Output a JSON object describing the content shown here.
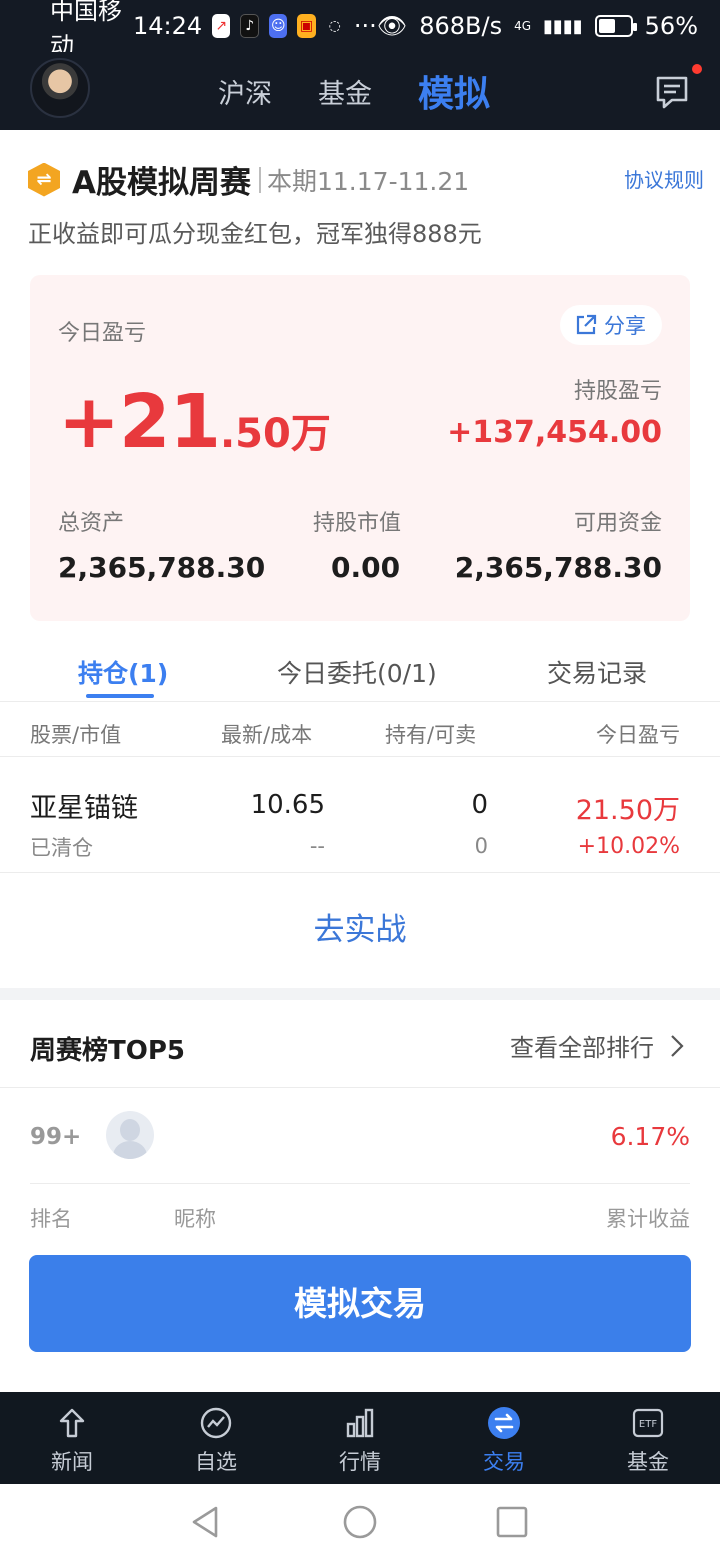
{
  "status_bar": {
    "carrier": "中国移动",
    "time": "14:24",
    "speed": "868B/s",
    "network": "4G",
    "battery": "56%",
    "battery_level": 0.56
  },
  "header": {
    "tabs": [
      "沪深",
      "基金",
      "模拟"
    ],
    "active_tab": "模拟",
    "message_icon": "message-icon"
  },
  "competition": {
    "badge": "⇌",
    "title": "A股模拟周赛",
    "period": "本期11.17-11.21",
    "rules_link": "协议规则",
    "promo": "正收益即可瓜分现金红包，冠军独得888元"
  },
  "summary": {
    "today_pnl_label": "今日盈亏",
    "share_label": "分享",
    "today_pnl_main": "+21",
    "today_pnl_sub": ".50万",
    "holding_pnl_label": "持股盈亏",
    "holding_pnl": "+137,454.00",
    "total_assets_label": "总资产",
    "total_assets": "2,365,788.30",
    "market_value_label": "持股市值",
    "market_value": "0.00",
    "available_cash_label": "可用资金",
    "available_cash": "2,365,788.30"
  },
  "tabs": [
    "持仓(1)",
    "今日委托(0/1)",
    "交易记录"
  ],
  "table": {
    "headers": [
      "股票/市值",
      "最新/成本",
      "持有/可卖",
      "今日盈亏"
    ],
    "rows": [
      {
        "name": "亚星锚链",
        "status": "已清仓",
        "latest": "10.65",
        "cost": "--",
        "holding": "0",
        "sellable": "0",
        "pnl": "21.50万",
        "pnl_pct": "+10.02%"
      }
    ]
  },
  "cta": "去实战",
  "ranking": {
    "title": "周赛榜TOP5",
    "view_all": "查看全部排行",
    "entry": {
      "rank": "99+",
      "return": "6.17%"
    },
    "footer": [
      "排名",
      "昵称",
      "累计收益"
    ]
  },
  "sim_button": "模拟交易",
  "bottom_nav": [
    "新闻",
    "自选",
    "行情",
    "交易",
    "基金"
  ],
  "bottom_nav_active": "交易",
  "etf_icon_text": "ETF",
  "colors": {
    "accent": "#3c7ff0",
    "gain": "#e8393d",
    "dark_bg": "#141a24",
    "card_bg": "#fef3f3"
  }
}
